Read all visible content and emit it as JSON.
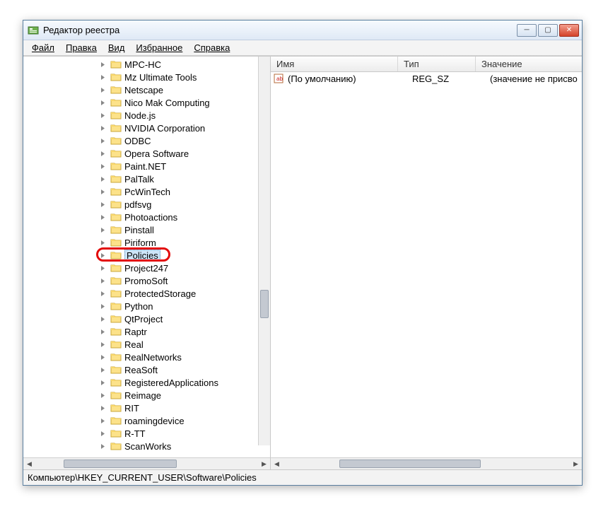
{
  "window": {
    "title": "Редактор реестра"
  },
  "menu": {
    "file": "Файл",
    "edit": "Правка",
    "view": "Вид",
    "favorites": "Избранное",
    "help": "Справка"
  },
  "tree": {
    "items": [
      {
        "label": "MPC-HC",
        "expandable": true
      },
      {
        "label": "Mz Ultimate Tools",
        "expandable": true
      },
      {
        "label": "Netscape",
        "expandable": true
      },
      {
        "label": "Nico Mak Computing",
        "expandable": true
      },
      {
        "label": "Node.js",
        "expandable": true
      },
      {
        "label": "NVIDIA Corporation",
        "expandable": true
      },
      {
        "label": "ODBC",
        "expandable": true
      },
      {
        "label": "Opera Software",
        "expandable": true
      },
      {
        "label": "Paint.NET",
        "expandable": true
      },
      {
        "label": "PalTalk",
        "expandable": true
      },
      {
        "label": "PcWinTech",
        "expandable": true
      },
      {
        "label": "pdfsvg",
        "expandable": true
      },
      {
        "label": "Photoactions",
        "expandable": true
      },
      {
        "label": "Pinstall",
        "expandable": true
      },
      {
        "label": "Piriform",
        "expandable": true
      },
      {
        "label": "Policies",
        "expandable": true,
        "selected": true,
        "highlighted": true
      },
      {
        "label": "Project247",
        "expandable": true
      },
      {
        "label": "PromoSoft",
        "expandable": true
      },
      {
        "label": "ProtectedStorage",
        "expandable": true
      },
      {
        "label": "Python",
        "expandable": true
      },
      {
        "label": "QtProject",
        "expandable": true
      },
      {
        "label": "Raptr",
        "expandable": true
      },
      {
        "label": "Real",
        "expandable": true
      },
      {
        "label": "RealNetworks",
        "expandable": true
      },
      {
        "label": "ReaSoft",
        "expandable": true
      },
      {
        "label": "RegisteredApplications",
        "expandable": true
      },
      {
        "label": "Reimage",
        "expandable": true
      },
      {
        "label": "RIT",
        "expandable": true
      },
      {
        "label": "roamingdevice",
        "expandable": true
      },
      {
        "label": "R-TT",
        "expandable": true
      },
      {
        "label": "ScanWorks",
        "expandable": true
      }
    ]
  },
  "list": {
    "columns": {
      "name": "Имя",
      "type": "Тип",
      "value": "Значение"
    },
    "rows": [
      {
        "name": "(По умолчанию)",
        "type": "REG_SZ",
        "value": "(значение не присво"
      }
    ]
  },
  "statusbar": {
    "path": "Компьютер\\HKEY_CURRENT_USER\\Software\\Policies"
  }
}
